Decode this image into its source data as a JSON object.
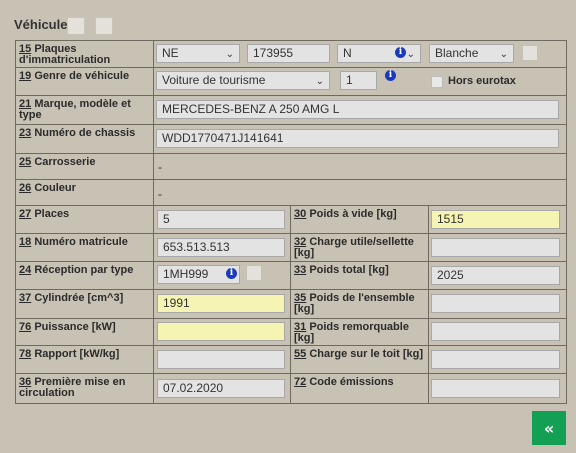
{
  "section_title": "Véhicule",
  "rows": {
    "plaques": {
      "num": "15",
      "label": "Plaques d'immatriculation",
      "canton": "NE",
      "number": "173955",
      "suffix": "N",
      "color": "Blanche"
    },
    "genre": {
      "num": "19",
      "label": "Genre de véhicule",
      "value": "Voiture de tourisme",
      "count": "1",
      "hors_eurotax": "Hors eurotax"
    },
    "marque": {
      "num": "21",
      "label": "Marque, modèle et type",
      "value": "MERCEDES-BENZ A 250 AMG L"
    },
    "chassis": {
      "num": "23",
      "label": "Numéro de chassis",
      "value": "WDD1770471J141641"
    },
    "carrosserie": {
      "num": "25",
      "label": "Carrosserie",
      "value": "-"
    },
    "couleur": {
      "num": "26",
      "label": "Couleur",
      "value": "-"
    },
    "places": {
      "num": "27",
      "label": "Places",
      "value": "5"
    },
    "poids_vide": {
      "num": "30",
      "label": "Poids à vide [kg]",
      "value": "1515"
    },
    "matricule": {
      "num": "18",
      "label": "Numéro matricule",
      "value": "653.513.513"
    },
    "charge_utile": {
      "num": "32",
      "label": "Charge utile/sellette [kg]",
      "value": ""
    },
    "reception": {
      "num": "24",
      "label": "Réception par type",
      "value": "1MH999"
    },
    "poids_total": {
      "num": "33",
      "label": "Poids total [kg]",
      "value": "2025"
    },
    "cylindree": {
      "num": "37",
      "label": "Cylindrée [cm^3]",
      "value": "1991"
    },
    "poids_ensemble": {
      "num": "35",
      "label": "Poids de l'ensemble [kg]",
      "value": ""
    },
    "puissance": {
      "num": "76",
      "label": "Puissance [kW]",
      "value": ""
    },
    "poids_remorquable": {
      "num": "31",
      "label": "Poids remorquable [kg]",
      "value": ""
    },
    "rapport": {
      "num": "78",
      "label": "Rapport [kW/kg]",
      "value": ""
    },
    "charge_toit": {
      "num": "55",
      "label": "Charge sur le toit [kg]",
      "value": ""
    },
    "premiere_mise": {
      "num": "36",
      "label": "Première mise en circulation",
      "value": "07.02.2020"
    },
    "code_emissions": {
      "num": "72",
      "label": "Code émissions",
      "value": ""
    }
  },
  "icons": {
    "info": "info-icon",
    "back": "double-chevron-left-icon",
    "info_glyph": "i",
    "back_glyph": "«"
  },
  "colors": {
    "highlight_field": "#f5f4b2",
    "button": "#14a054",
    "background": "#c8c2b4"
  }
}
